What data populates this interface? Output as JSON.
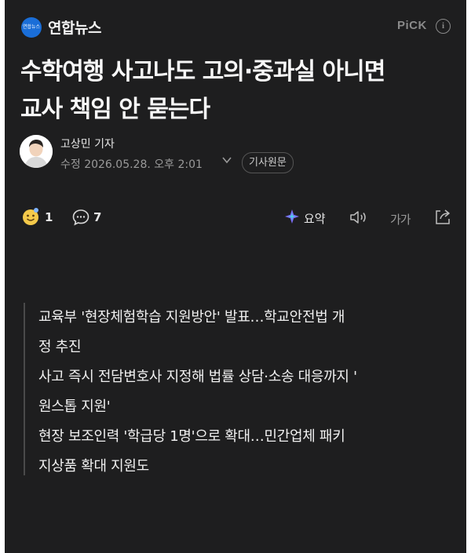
{
  "press": {
    "logo_text": "연합뉴스",
    "name": "연합뉴스",
    "pick_label": "PiCK",
    "info_icon": "info-icon"
  },
  "article": {
    "title_line1": "수학여행 사고나도 고의·중과실 아니면",
    "title_line2": "교사 책임 안 묻는다",
    "reporter": "고상민 기자",
    "date": "수정 2026.05.28. 오후 2:01",
    "original_button": "기사원문"
  },
  "toolbar": {
    "reaction_icon": "smiley-reaction-icon",
    "reaction_count": "1",
    "comment_icon": "comment-bubble-icon",
    "comment_count": "7",
    "summary_icon": "ai-summary-icon",
    "summary_label": "요약",
    "audio_icon": "speaker-icon",
    "font_size_label": "가가",
    "share_icon": "share-icon"
  },
  "subheads": {
    "line1": "교육부 '현장체험학습 지원방안' 발표…학교안전법 개",
    "line2": "정 추진",
    "line3": "사고 즉시 전담변호사 지정해 법률 상담·소송 대응까지 '",
    "line4": "원스톱 지원'",
    "line5": "현장 보조인력 '학급당 1명'으로 확대…민간업체 패키",
    "line6": "지상품 확대 지원도"
  },
  "colors": {
    "background": "#1e1e1f",
    "text": "#f8f8f8",
    "muted": "#9a9a9a",
    "logo_blue": "#1a6ed8"
  }
}
